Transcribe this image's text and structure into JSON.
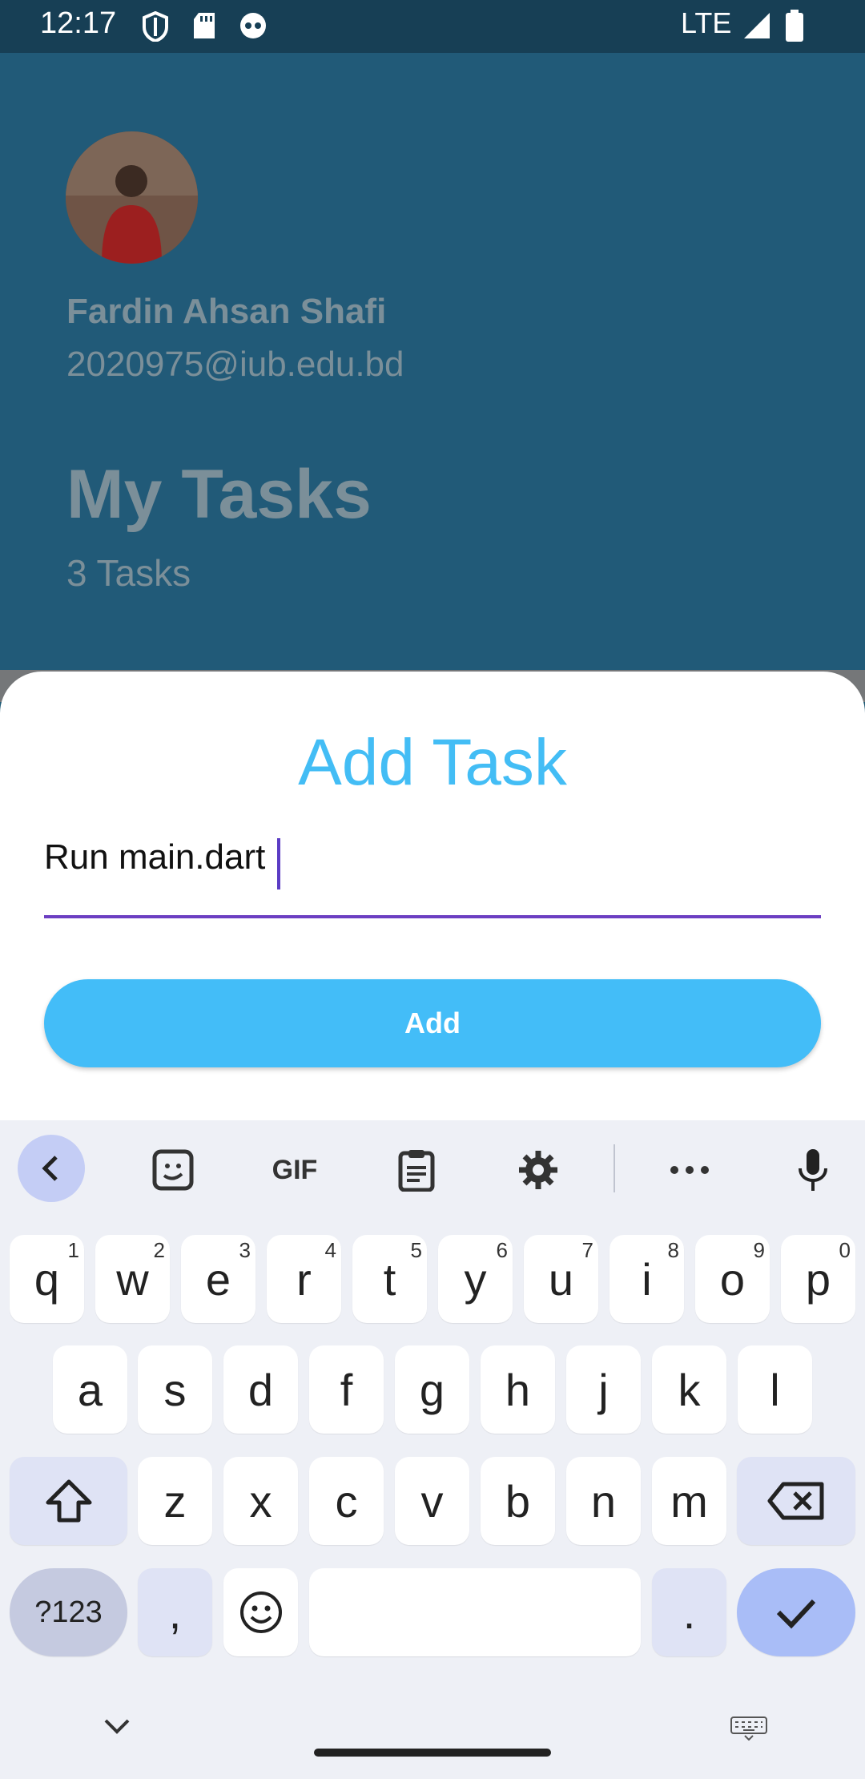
{
  "status_bar": {
    "time": "12:17",
    "network": "LTE"
  },
  "profile": {
    "name": "Fardin Ahsan Shafi",
    "email": "2020975@iub.edu.bd"
  },
  "tasks_header": {
    "title": "My Tasks",
    "count": "3 Tasks"
  },
  "sheet": {
    "title": "Add Task",
    "input_value": "Run main.dart",
    "button_label": "Add"
  },
  "colors": {
    "accent": "#43bdf8",
    "focus": "#6c3fc2",
    "dim_bg": "#215a78"
  },
  "keyboard": {
    "toolbar": [
      "chevron-left-icon",
      "sticker-icon",
      "GIF",
      "clipboard-icon",
      "gear-icon",
      "more-icon",
      "mic-icon"
    ],
    "gif_label": "GIF",
    "row1": [
      {
        "k": "q",
        "h": "1"
      },
      {
        "k": "w",
        "h": "2"
      },
      {
        "k": "e",
        "h": "3"
      },
      {
        "k": "r",
        "h": "4"
      },
      {
        "k": "t",
        "h": "5"
      },
      {
        "k": "y",
        "h": "6"
      },
      {
        "k": "u",
        "h": "7"
      },
      {
        "k": "i",
        "h": "8"
      },
      {
        "k": "o",
        "h": "9"
      },
      {
        "k": "p",
        "h": "0"
      }
    ],
    "row2": [
      "a",
      "s",
      "d",
      "f",
      "g",
      "h",
      "j",
      "k",
      "l"
    ],
    "row3": [
      "z",
      "x",
      "c",
      "v",
      "b",
      "n",
      "m"
    ],
    "symbols_label": "?123",
    "comma": ",",
    "period": "."
  }
}
